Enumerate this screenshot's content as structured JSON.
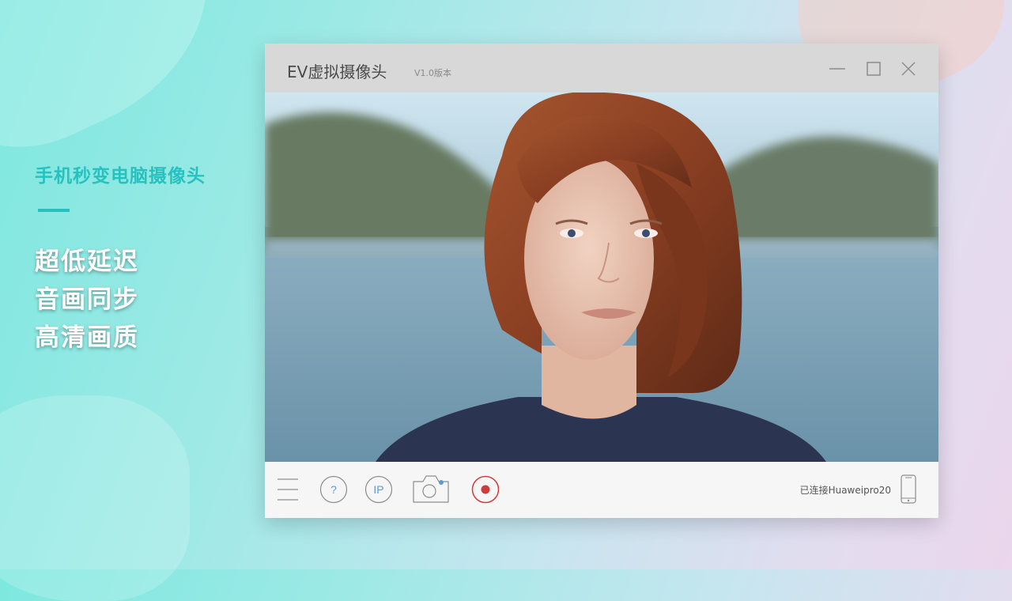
{
  "promo": {
    "title": "手机秒变电脑摄像头",
    "features": [
      "超低延迟",
      "音画同步",
      "高清画质"
    ]
  },
  "window": {
    "title": "EV虚拟摄像头",
    "version": "V1.0版本"
  },
  "toolbar": {
    "help_label": "?",
    "ip_label": "IP",
    "status": "已连接Huaweipro20"
  },
  "colors": {
    "accent": "#27c1c0",
    "record": "#d23b3b",
    "icon_blue": "#5b9bd5",
    "icon_gray": "#8c8c8c"
  },
  "icons": {
    "menu": "menu-icon",
    "help": "help-icon",
    "ip": "ip-icon",
    "camera": "camera-icon",
    "record": "record-icon",
    "phone": "phone-icon",
    "minimize": "minimize-icon",
    "maximize": "maximize-icon",
    "close": "close-icon"
  }
}
